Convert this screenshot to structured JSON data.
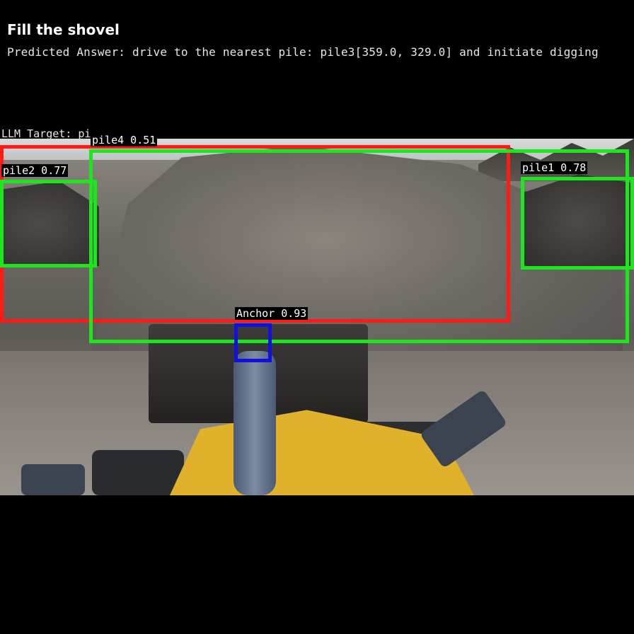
{
  "header": {
    "title": "Fill the shovel",
    "predicted_answer": "Predicted Answer: drive to the nearest pile: pile3[359.0, 329.0] and initiate digging",
    "llm_target": "LLM Target: pi"
  },
  "detections": {
    "pile4": {
      "label": "pile4 0.51",
      "color": "#ff1a1a"
    },
    "pile2": {
      "label": "pile2 0.77",
      "color": "#1ee61e"
    },
    "pile1": {
      "label": "pile1 0.78",
      "color": "#1ee61e"
    },
    "big_green": {
      "color": "#1ee61e"
    },
    "anchor": {
      "label": "Anchor 0.93",
      "color": "#1010e0"
    }
  }
}
